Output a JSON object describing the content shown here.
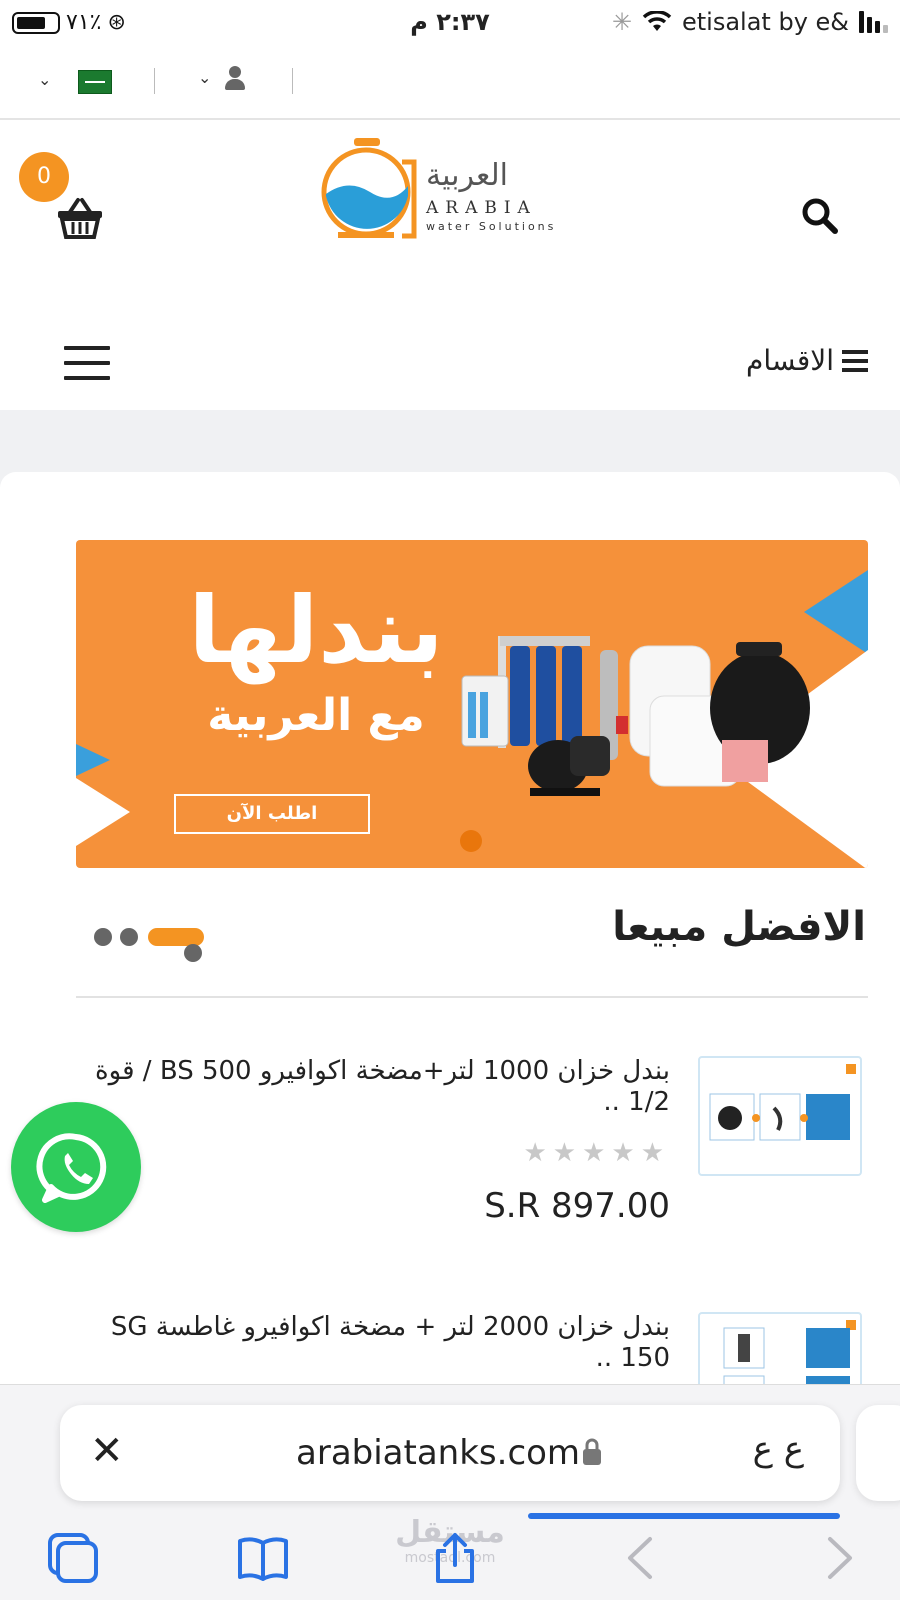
{
  "status_bar": {
    "battery": "٧١٪",
    "time": "٢:٣٧ م",
    "carrier": "etisalat by e&"
  },
  "header": {
    "cart_count": "0",
    "logo": {
      "arabic": "العربية",
      "english": "ARABIA",
      "tagline": "water Solutions"
    },
    "categories_label": "الاقسام"
  },
  "banner": {
    "headline": "بندلها",
    "subline": "مع العربية",
    "cta": "اطلب الآن"
  },
  "bestsellers": {
    "title": "الافضل مبيعا",
    "products": [
      {
        "title": "بندل خزان 1000 لتر+مضخة اكوافيرو BS 500 / قوة 1/2 ..",
        "rating": 0,
        "stars": "★★★★★",
        "price": "S.R 897.00"
      },
      {
        "title": "بندل خزان 2000 لتر + مضخة اكوافيرو غاطسة SG 150 ..",
        "rating": 0,
        "stars": "★★★★★",
        "price": ""
      }
    ]
  },
  "browser": {
    "url": "arabiatanks.com",
    "text_size_button": "ع ع",
    "progress": 0.4,
    "watermark": "مستقل",
    "watermark_sub": "mostaql.com"
  },
  "colors": {
    "accent": "#f49422",
    "banner": "#f5913a",
    "whatsapp": "#2ecc5c",
    "progress": "#2a72e4"
  }
}
